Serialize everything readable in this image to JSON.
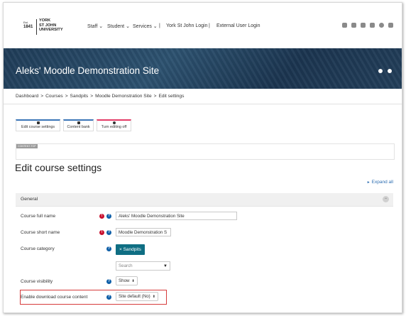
{
  "logo": {
    "est": "Est.",
    "year": "1841",
    "line1": "YORK",
    "line2": "ST JOHN",
    "line3": "UNIVERSITY"
  },
  "nav": {
    "items": [
      "Staff",
      "Student",
      "Services"
    ],
    "york_login": "York St John Login",
    "external_login": "External User Login",
    "caret": "⌄"
  },
  "top_icons": [
    "bell-icon",
    "chat-icon",
    "accessibility-icon",
    "settings-sliders-icon",
    "search-icon",
    "menu-icon"
  ],
  "banner": {
    "site_title": "Aleks' Moodle Demonstration Site"
  },
  "breadcrumb": {
    "items": [
      "Dashboard",
      "Courses",
      "Sandpits",
      "Moodle Demonstration Site",
      "Edit settings"
    ],
    "sep": ">"
  },
  "tabs": [
    {
      "label": "Edit course settings",
      "icon": "gear-icon"
    },
    {
      "label": "Content bank",
      "icon": "brush-icon"
    },
    {
      "label": "Turn editing off",
      "icon": "power-icon"
    }
  ],
  "content_top_label": "CONTENT-TOP",
  "page_title": "Edit course settings",
  "expand_all": "Expand all",
  "section": {
    "title": "General"
  },
  "fields": {
    "full_name": {
      "label": "Course full name",
      "value": "Aleks' Moodle Demonstration Site"
    },
    "short_name": {
      "label": "Course short name",
      "value": "Moodle Demonstration S"
    },
    "category": {
      "label": "Course category",
      "chip": "× Sandpits",
      "search_placeholder": "Search",
      "dropdown": "▼"
    },
    "visibility": {
      "label": "Course visibility",
      "value": "Show"
    },
    "download": {
      "label": "Enable download course content",
      "value": "Site default (No)"
    }
  },
  "glyphs": {
    "required": "!",
    "help": "?",
    "collapse": "−",
    "select_caret": "⬍",
    "expand_tri": "►"
  },
  "colors": {
    "accent_blue": "#3a74b7",
    "accent_pink": "#e33b66",
    "chip_teal": "#0f6e83",
    "required_red": "#c8102e",
    "highlight_red": "#d63b3b"
  }
}
